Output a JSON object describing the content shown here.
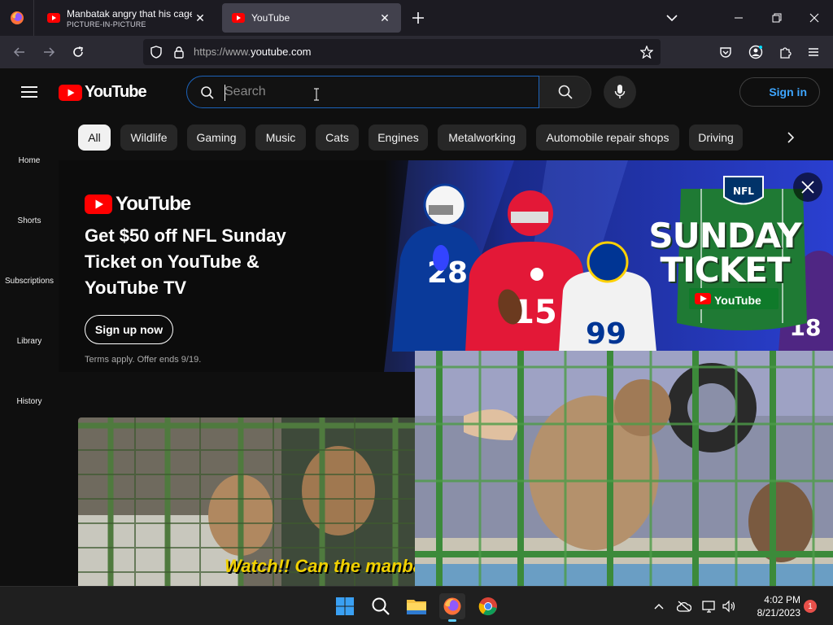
{
  "browser": {
    "tabs": [
      {
        "title": "Manbatak angry that his cage is",
        "subtitle": "PICTURE-IN-PICTURE"
      },
      {
        "title": "YouTube"
      }
    ],
    "url_prefix": "https://www.",
    "url_host": "youtube.com"
  },
  "youtube": {
    "logo_text": "YouTube",
    "search_placeholder": "Search",
    "signin_label": "Sign in",
    "chips": [
      "All",
      "Wildlife",
      "Gaming",
      "Music",
      "Cats",
      "Engines",
      "Metalworking",
      "Automobile repair shops",
      "Driving"
    ],
    "active_chip": "All",
    "sidebar": [
      "Home",
      "Shorts",
      "Subscriptions",
      "Library",
      "History"
    ]
  },
  "banner": {
    "logo_text": "YouTube",
    "headline": "Get $50 off NFL Sunday Ticket on YouTube & YouTube TV",
    "cta_label": "Sign up now",
    "terms": "Terms apply. Offer ends 9/19.",
    "sunday_ticket_title": "SUNDAY TICKET",
    "sunday_ticket_logo": "YouTube",
    "nfl_shield_text": "NFL",
    "jersey_numbers": [
      "28",
      "15",
      "99",
      "18"
    ]
  },
  "video": {
    "thumbnail_caption": "Watch!! Can the manbatak op"
  },
  "taskbar": {
    "time": "4:02 PM",
    "date": "8/21/2023",
    "notification_count": "1"
  },
  "colors": {
    "youtube_red": "#ff0000",
    "link_blue": "#3ea6ff",
    "search_focus": "#1c62b9"
  }
}
